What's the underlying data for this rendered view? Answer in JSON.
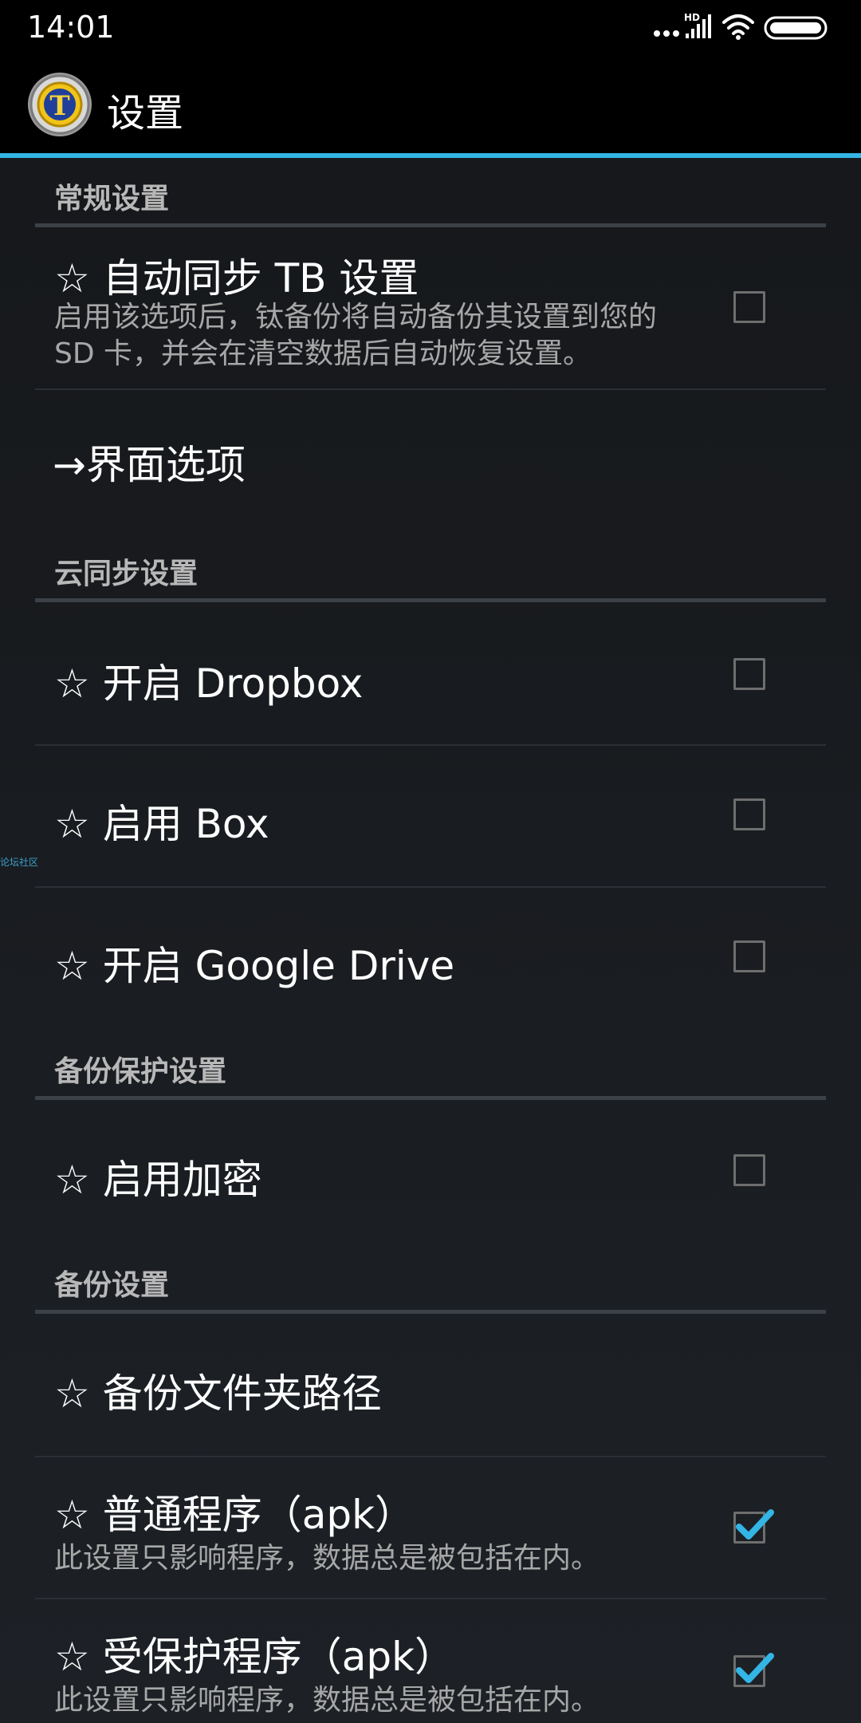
{
  "status_bar": {
    "time": "14:01",
    "network_label": "HD",
    "icons": [
      "more-dots-icon",
      "signal-icon",
      "wifi-icon",
      "battery-icon"
    ]
  },
  "action_bar": {
    "title": "设置",
    "logo_letter": "T"
  },
  "colors": {
    "accent": "#33b5e5",
    "background": "#16181b",
    "section_header": "#b8b8b8"
  },
  "sections": {
    "general": {
      "header": "常规设置",
      "auto_sync_title": "☆ 自动同步 TB 设置",
      "auto_sync_summary": "启用该选项后，钛备份将自动备份其设置到您的 SD 卡，并会在清空数据后自动恢复设置。",
      "auto_sync_checked": false,
      "interface_title": "→界面选项"
    },
    "cloud": {
      "header": "云同步设置",
      "dropbox_title": "☆ 开启 Dropbox",
      "dropbox_checked": false,
      "box_title": "☆ 启用 Box",
      "box_checked": false,
      "gdrive_title": "☆ 开启 Google Drive",
      "gdrive_checked": false
    },
    "protection": {
      "header": "备份保护设置",
      "encryption_title": "☆ 启用加密",
      "encryption_checked": false
    },
    "backup": {
      "header": "备份设置",
      "folder_title": "☆ 备份文件夹路径",
      "apk_title": "☆ 普通程序（apk）",
      "apk_summary": "此设置只影响程序，数据总是被包括在内。",
      "apk_checked": true,
      "protected_apk_title": "☆ 受保护程序（apk）",
      "protected_apk_summary": "此设置只影响程序，数据总是被包括在内。",
      "protected_apk_checked": true
    }
  },
  "watermark": "论坛社区"
}
